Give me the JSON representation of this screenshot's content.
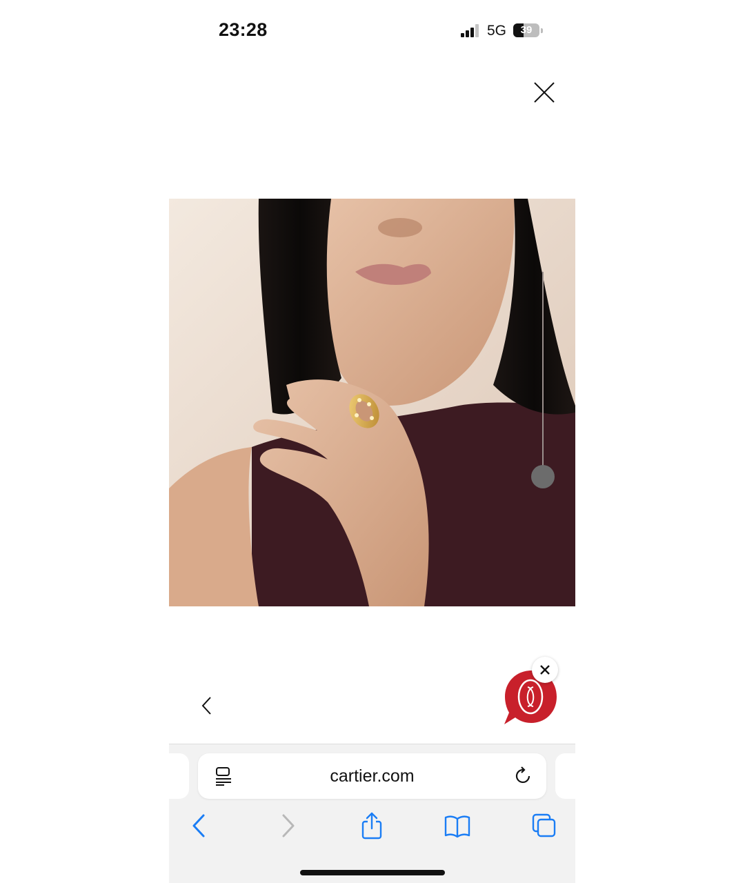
{
  "status_bar": {
    "time": "23:28",
    "network": "5G",
    "battery_percent": "39",
    "battery_level": 0.39,
    "signal_icon": "cellular-signal-icon",
    "battery_icon": "battery-icon"
  },
  "viewer": {
    "close_icon": "close-icon",
    "image_subject": "model-wearing-gold-ring",
    "zoom_slider_icon": "zoom-slider-knob",
    "prev_icon": "chevron-left-icon"
  },
  "chat_widget": {
    "logo_icon": "cartier-double-c-logo-icon",
    "close_icon": "close-icon",
    "brand_color": "#c8202b"
  },
  "browser": {
    "url": "cartier.com",
    "reader_icon": "page-menu-icon",
    "reload_icon": "reload-icon",
    "nav": {
      "back_icon": "chevron-left-icon",
      "forward_icon": "chevron-right-icon",
      "share_icon": "share-icon",
      "bookmarks_icon": "book-icon",
      "tabs_icon": "tabs-icon"
    },
    "accent_color": "#1a7df5"
  }
}
